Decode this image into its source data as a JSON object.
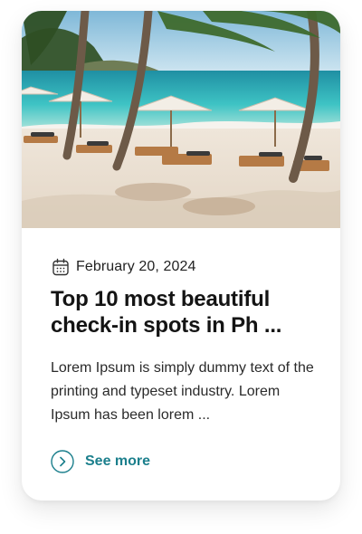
{
  "card": {
    "image_alt": "Tropical beach with palm trees and sun loungers",
    "date": "February 20, 2024",
    "title": "Top 10 most beautiful check-in spots in Ph ...",
    "excerpt": "Lorem Ipsum is simply dummy text of the printing and typeset industry. Lorem Ipsum has been lorem ...",
    "cta_label": "See more",
    "icons": {
      "date": "calendar-icon",
      "cta": "chevron-right-circle-icon"
    },
    "colors": {
      "accent": "#1b7f8c",
      "title": "#141414",
      "text": "#2a2a2a"
    }
  }
}
